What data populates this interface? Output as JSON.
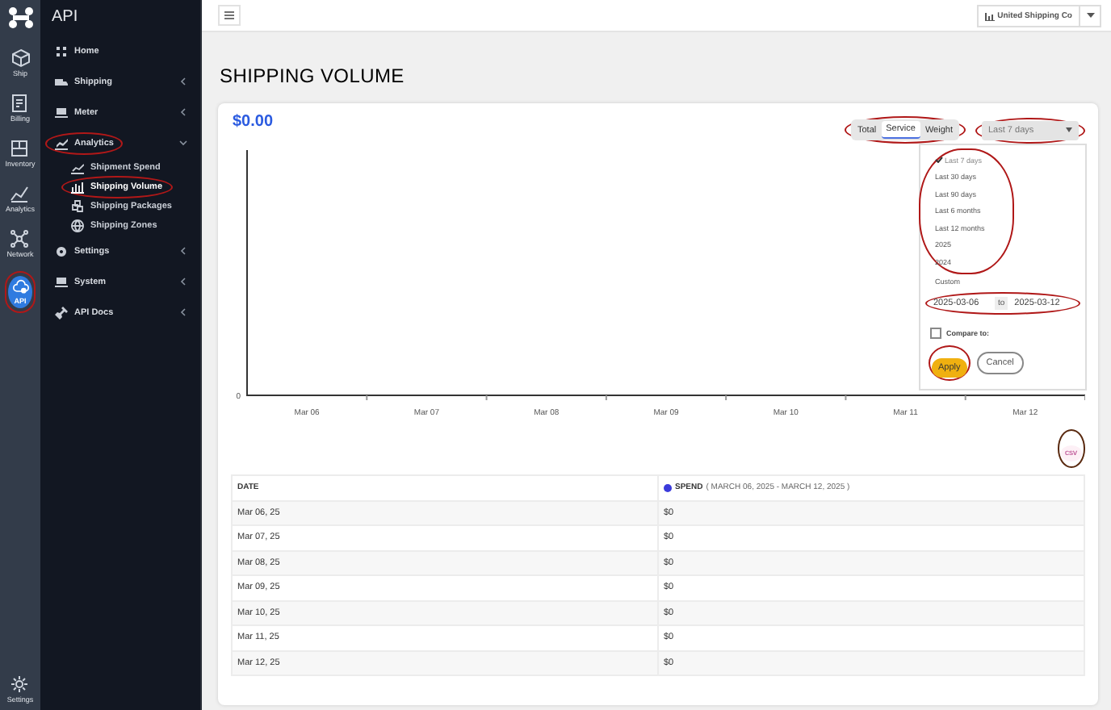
{
  "rail": {
    "items": [
      {
        "label": "Ship",
        "selected": false,
        "annotated": false
      },
      {
        "label": "Billing",
        "selected": false,
        "annotated": false
      },
      {
        "label": "Inventory",
        "selected": false,
        "annotated": false
      },
      {
        "label": "Analytics",
        "selected": false,
        "annotated": false
      },
      {
        "label": "Network",
        "selected": false,
        "annotated": false
      },
      {
        "label": "API",
        "selected": true,
        "annotated": true
      }
    ],
    "bottom": {
      "label": "Settings"
    }
  },
  "sidebar": {
    "title": "API",
    "items": [
      {
        "label": "Home",
        "annotated": false
      },
      {
        "label": "Shipping",
        "expanded": false,
        "annotated": false
      },
      {
        "label": "Meter",
        "expanded": false,
        "annotated": false
      },
      {
        "label": "Analytics",
        "expanded": true,
        "annotated": true,
        "children": [
          {
            "label": "Shipment Spend",
            "selected": false,
            "annotated": false
          },
          {
            "label": "Shipping Volume",
            "selected": true,
            "annotated": true
          },
          {
            "label": "Shipping Packages",
            "selected": false,
            "annotated": false
          },
          {
            "label": "Shipping Zones",
            "selected": false,
            "annotated": false
          }
        ]
      },
      {
        "label": "Settings",
        "expanded": false,
        "annotated": false
      },
      {
        "label": "System",
        "expanded": false,
        "annotated": false
      },
      {
        "label": "API Docs",
        "expanded": false,
        "annotated": false
      }
    ]
  },
  "top_bar": {
    "company": "United Shipping Co"
  },
  "page_title": "SHIPPING VOLUME",
  "card": {
    "total": "$0.00",
    "metric_tabs": {
      "annotated": true,
      "items": [
        {
          "label": "Total",
          "selected": false
        },
        {
          "label": "Service",
          "selected": true
        },
        {
          "label": "Weight",
          "selected": false
        }
      ]
    },
    "range_select": {
      "value": "Last 7 days",
      "annotated": true
    },
    "range_menu": {
      "options_annotated": true,
      "options": [
        {
          "label": "Last 7 days",
          "selected": true
        },
        {
          "label": "Last 30 days",
          "selected": false
        },
        {
          "label": "Last 90 days",
          "selected": false
        },
        {
          "label": "Last 6 months",
          "selected": false
        },
        {
          "label": "Last 12 months",
          "selected": false
        },
        {
          "label": "2025",
          "selected": false
        },
        {
          "label": "2024",
          "selected": false
        },
        {
          "label": "Custom",
          "selected": false
        }
      ],
      "from": "2025-03-06",
      "to_label": "to",
      "to": "2025-03-12",
      "dates_annotated": true,
      "compare": {
        "label": "Compare to:",
        "checked": false
      },
      "apply": {
        "label": "Apply",
        "annotated": true
      },
      "cancel": "Cancel"
    },
    "chart": {
      "y_tick": "0",
      "x_labels": [
        "Mar 06",
        "Mar 07",
        "Mar 08",
        "Mar 09",
        "Mar 10",
        "Mar 11",
        "Mar 12"
      ]
    },
    "csv": {
      "label": "csv",
      "annotated": true
    },
    "table": {
      "columns": [
        {
          "label": "DATE"
        },
        {
          "label": "SPEND",
          "range": "( MARCH 06, 2025 - MARCH 12, 2025 )",
          "color": "#3b3bdb"
        }
      ],
      "rows": [
        [
          "Mar 06, 25",
          "$0"
        ],
        [
          "Mar 07, 25",
          "$0"
        ],
        [
          "Mar 08, 25",
          "$0"
        ],
        [
          "Mar 09, 25",
          "$0"
        ],
        [
          "Mar 10, 25",
          "$0"
        ],
        [
          "Mar 11, 25",
          "$0"
        ],
        [
          "Mar 12, 25",
          "$0"
        ]
      ]
    }
  }
}
